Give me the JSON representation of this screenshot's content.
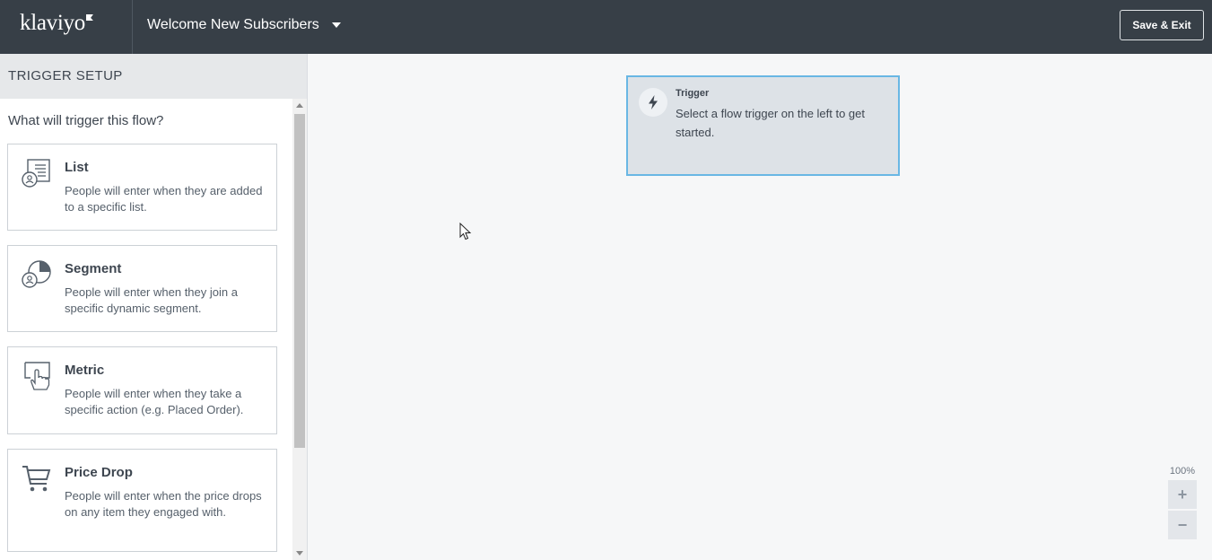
{
  "header": {
    "logo_text": "klaviyo",
    "flow_name": "Welcome New Subscribers",
    "save_exit_label": "Save & Exit"
  },
  "sidebar": {
    "header_title": "TRIGGER SETUP",
    "question": "What will trigger this flow?",
    "triggers": [
      {
        "title": "List",
        "description": "People will enter when they are added to a specific list.",
        "icon": "list-person-icon"
      },
      {
        "title": "Segment",
        "description": "People will enter when they join a specific dynamic segment.",
        "icon": "segment-pie-icon"
      },
      {
        "title": "Metric",
        "description": "People will enter when they take a specific action (e.g. Placed Order).",
        "icon": "hand-pointer-icon"
      },
      {
        "title": "Price Drop",
        "description": "People will enter when the price drops on any item they engaged with.",
        "icon": "shopping-cart-icon"
      }
    ]
  },
  "canvas": {
    "trigger_node": {
      "label": "Trigger",
      "description": "Select a flow trigger on the left to get started.",
      "icon": "lightning-bolt-icon"
    },
    "zoom": {
      "level": "100%",
      "zoom_in_label": "+",
      "zoom_out_label": "−"
    }
  },
  "colors": {
    "header_bg": "#373f47",
    "node_border": "#69b7e4",
    "node_bg": "#dde2e7"
  }
}
